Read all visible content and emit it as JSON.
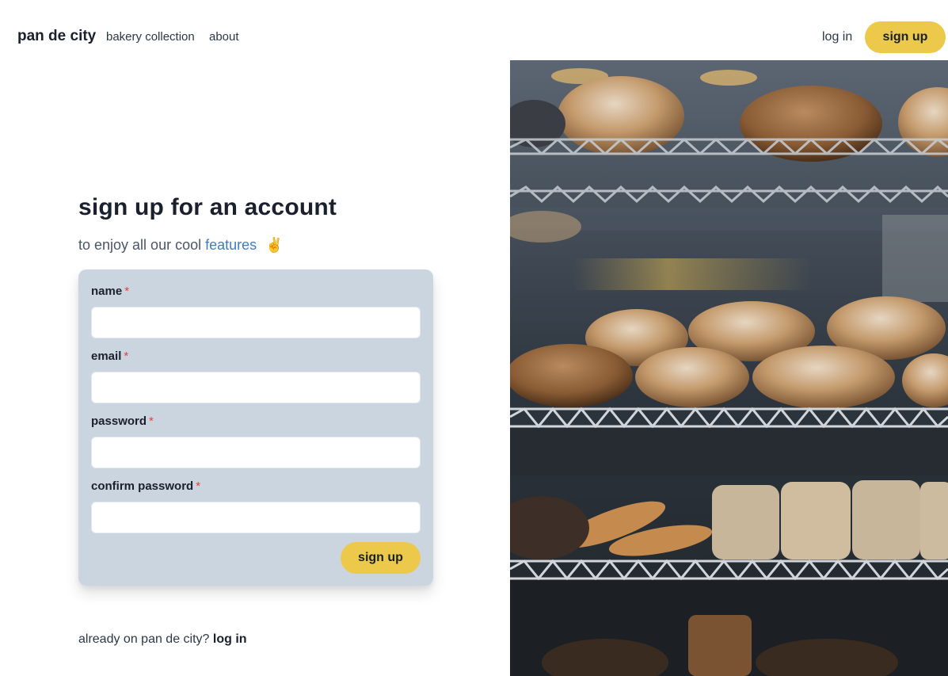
{
  "nav": {
    "brand": "pan de city",
    "links": [
      "bakery collection",
      "about"
    ],
    "login": "log in",
    "signup": "sign up"
  },
  "hero": {
    "title": "sign up for an account",
    "subtitle_prefix": "to enjoy all our cool",
    "subtitle_link": "features",
    "subtitle_emoji": "✌️"
  },
  "form": {
    "required_mark": "*",
    "fields": [
      {
        "label": "name",
        "value": ""
      },
      {
        "label": "email",
        "value": ""
      },
      {
        "label": "password",
        "value": ""
      },
      {
        "label": "confirm password",
        "value": ""
      }
    ],
    "submit": "sign up"
  },
  "footer": {
    "prompt": "already on pan de city?",
    "login": "log in"
  },
  "colors": {
    "accent": "#ecc94b",
    "card": "#cbd5e0",
    "link": "#3f7cc0",
    "required": "#e53e3e"
  },
  "icons": {
    "hero_emoji": "victory-hand-icon"
  }
}
